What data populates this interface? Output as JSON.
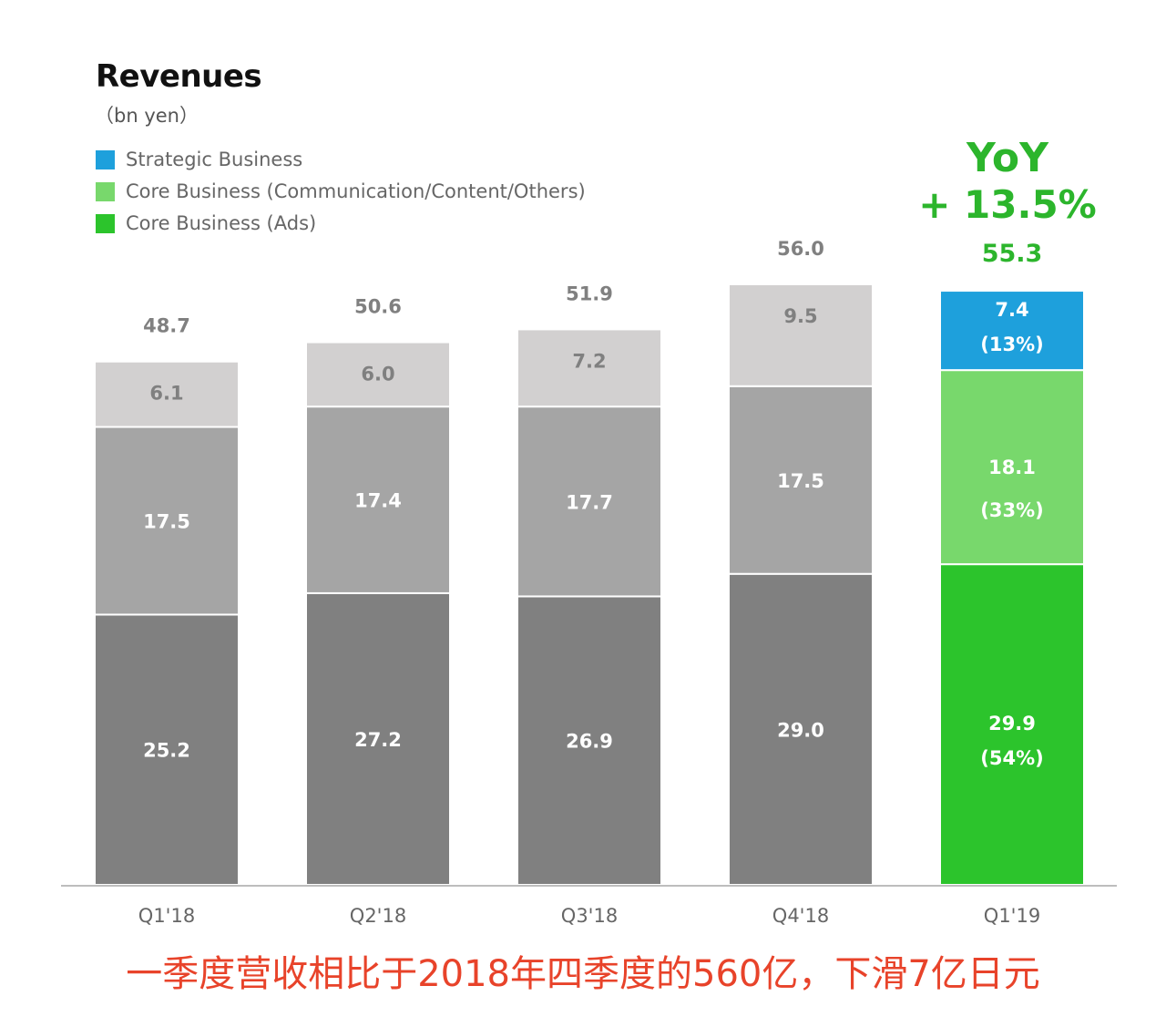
{
  "header": {
    "title": "Revenues",
    "unit": "（bn yen）"
  },
  "legend": [
    {
      "label": "Strategic Business",
      "color": "#1ea0dc"
    },
    {
      "label": "Core Business (Communication/Content/Others)",
      "color": "#78d86c"
    },
    {
      "label": "Core Business (Ads)",
      "color": "#2cc42c"
    }
  ],
  "yoy": {
    "title": "YoY",
    "value": "+ 13.5%"
  },
  "caption": "一季度营收相比于2018年四季度的560亿，下滑7亿日元",
  "chart_data": {
    "type": "bar",
    "stacked": true,
    "title": "Revenues",
    "subtitle": "(bn yen)",
    "xlabel": "",
    "ylabel": "",
    "ylim": [
      0,
      56.0
    ],
    "grid": false,
    "legend_position": "top-left",
    "categories": [
      "Q1'18",
      "Q2'18",
      "Q3'18",
      "Q4'18",
      "Q1'19"
    ],
    "totals": [
      48.7,
      50.6,
      51.9,
      56.0,
      55.3
    ],
    "series": [
      {
        "name": "Core Business (Ads)",
        "values": [
          25.2,
          27.2,
          26.9,
          29.0,
          29.9
        ],
        "labels": [
          "25.2",
          "27.2",
          "26.9",
          "29.0",
          "29.9"
        ],
        "share_labels": [
          null,
          null,
          null,
          null,
          "(54%)"
        ],
        "colors": [
          "#808080",
          "#808080",
          "#808080",
          "#808080",
          "#2cc42c"
        ]
      },
      {
        "name": "Core Business (Communication/Content/Others)",
        "values": [
          17.5,
          17.4,
          17.7,
          17.5,
          18.1
        ],
        "labels": [
          "17.5",
          "17.4",
          "17.7",
          "17.5",
          "18.1"
        ],
        "share_labels": [
          null,
          null,
          null,
          null,
          "(33%)"
        ],
        "colors": [
          "#a5a5a5",
          "#a5a5a5",
          "#a5a5a5",
          "#a5a5a5",
          "#78d86c"
        ]
      },
      {
        "name": "Strategic Business",
        "values": [
          6.1,
          6.0,
          7.2,
          9.5,
          7.4
        ],
        "labels": [
          "6.1",
          "6.0",
          "7.2",
          "9.5",
          "7.4"
        ],
        "share_labels": [
          null,
          null,
          null,
          null,
          "(13%)"
        ],
        "colors": [
          "#d2d0d0",
          "#d2d0d0",
          "#d2d0d0",
          "#d2d0d0",
          "#1ea0dc"
        ]
      }
    ],
    "total_label_colors": [
      "#808080",
      "#808080",
      "#808080",
      "#808080",
      "#2cb52c"
    ],
    "annotations": [
      "YoY + 13.5%"
    ]
  }
}
